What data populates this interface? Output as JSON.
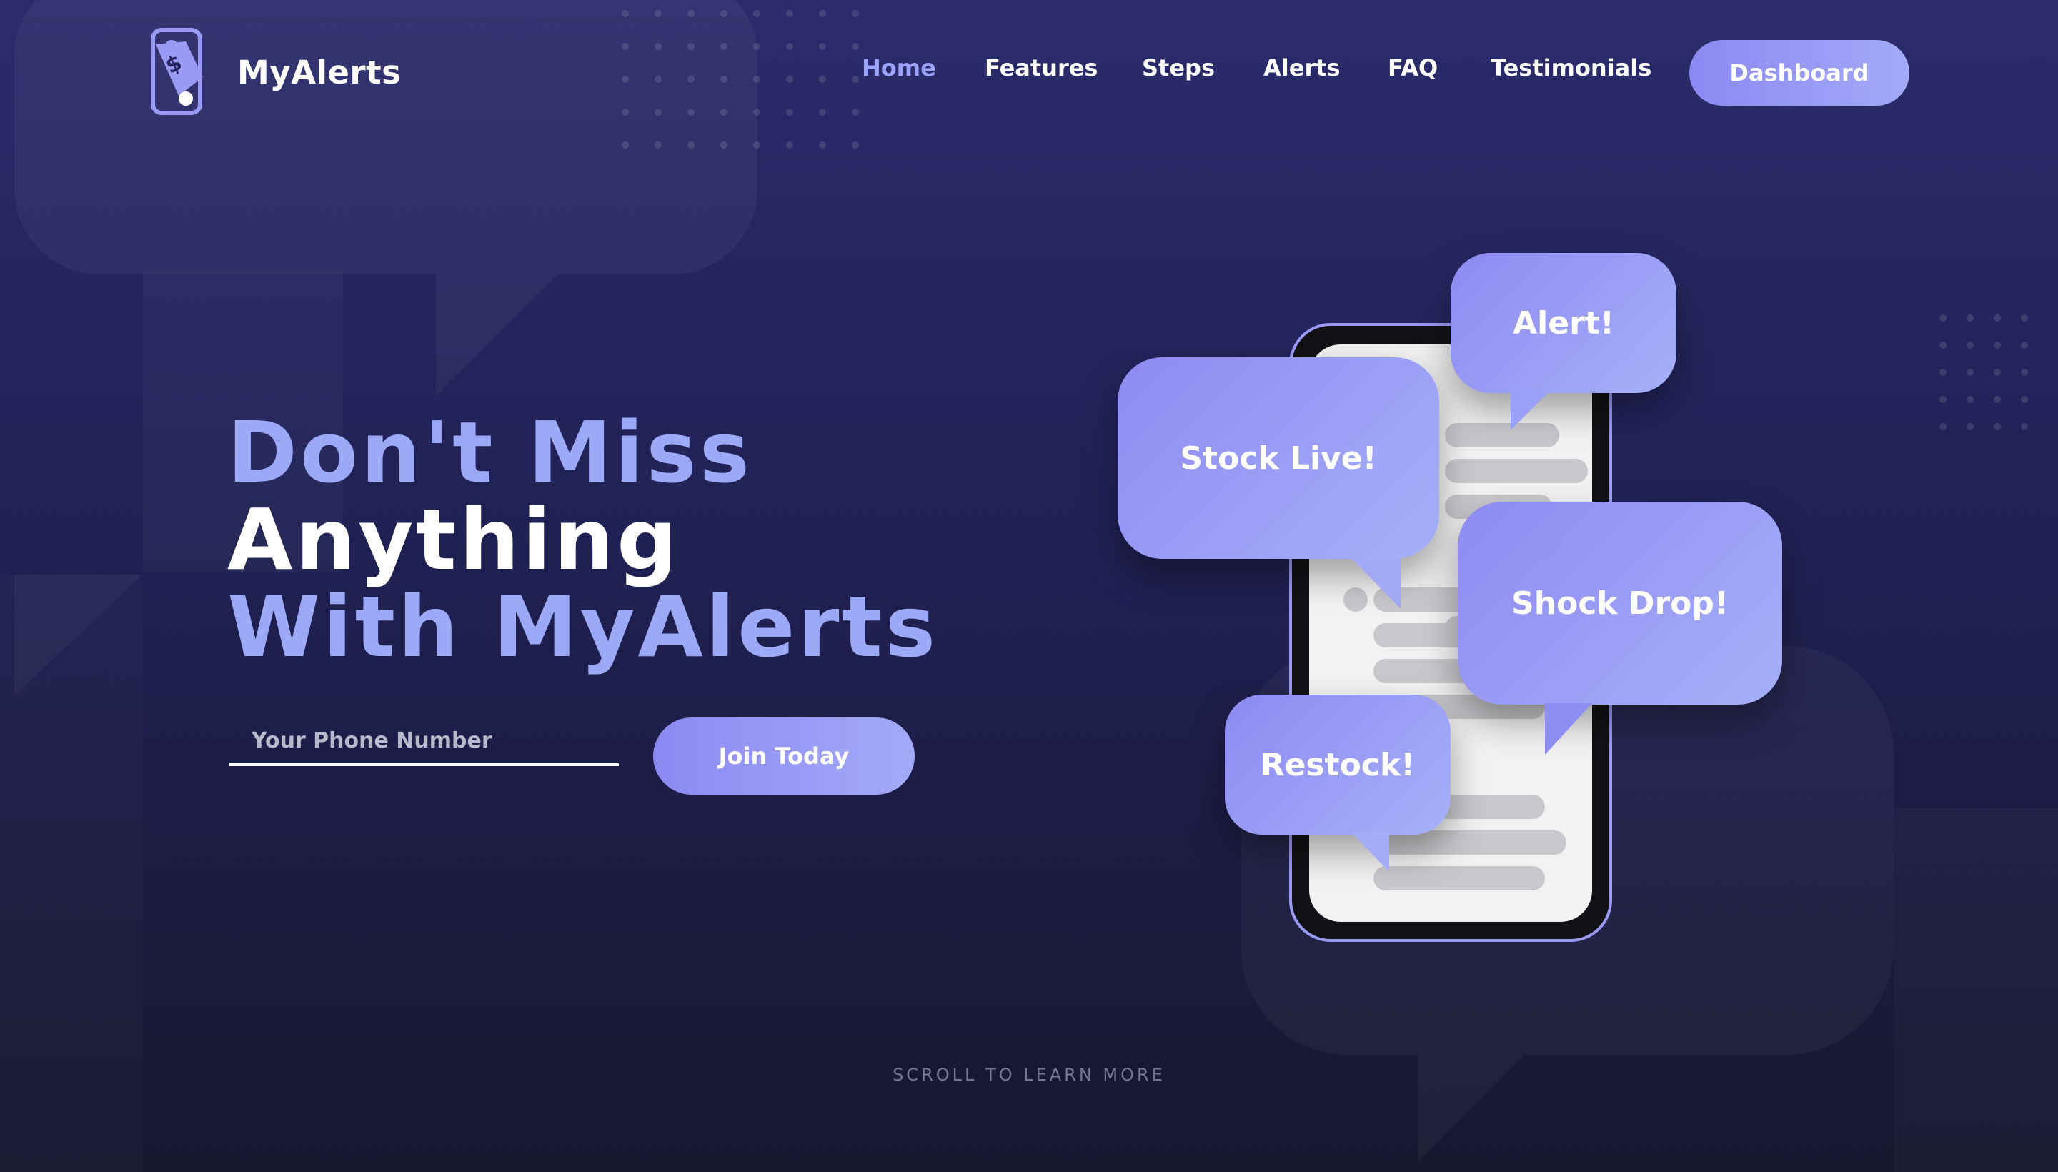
{
  "brand": {
    "name": "MyAlerts",
    "logo_icon": "bell-dollar-phone-icon"
  },
  "nav": {
    "items": [
      {
        "label": "Home",
        "active": true
      },
      {
        "label": "Features",
        "active": false
      },
      {
        "label": "Steps",
        "active": false
      },
      {
        "label": "Alerts",
        "active": false
      },
      {
        "label": "FAQ",
        "active": false
      },
      {
        "label": "Testimonials",
        "active": false
      }
    ],
    "dashboard_label": "Dashboard"
  },
  "hero": {
    "headline_line1": "Don't Miss",
    "headline_line2": "Anything",
    "headline_line3": "With MyAlerts",
    "phone_placeholder": "Your Phone Number",
    "join_label": "Join Today"
  },
  "illustration": {
    "bubbles": [
      "Alert!",
      "Stock Live!",
      "Shock Drop!",
      "Restock!"
    ]
  },
  "scroll_hint": "SCROLL TO LEARN MORE",
  "colors": {
    "accent": "#9ba9f6",
    "button_start": "#8b89f2",
    "button_end": "#a3aaf8",
    "background_top": "#2b2c6c",
    "background_bottom": "#17172e"
  }
}
